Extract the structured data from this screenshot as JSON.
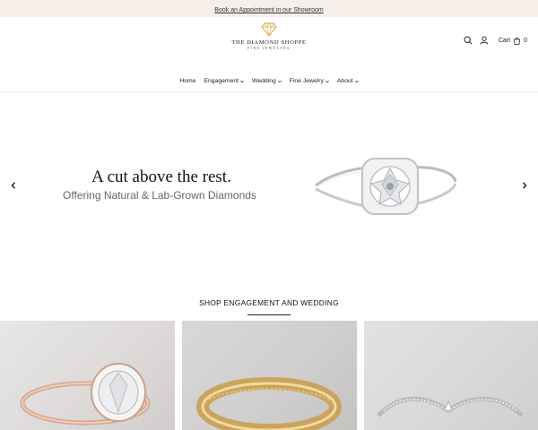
{
  "announcement": {
    "link_text": "Book an Appointment in our Showroom"
  },
  "logo": {
    "brand": "THE DIAMOND SHOPPE",
    "tagline": "FINE JEWELERS",
    "icon": "diamond-icon"
  },
  "header": {
    "search_icon": "search-icon",
    "account_icon": "user-icon",
    "cart_label": "Cart",
    "cart_icon": "bag-icon",
    "cart_count": "0"
  },
  "nav": {
    "home": "Home",
    "engagement": "Engagement",
    "wedding": "Wedding",
    "fine_jewelry": "Fine Jewelry",
    "about": "About"
  },
  "hero": {
    "title": "A cut above the rest.",
    "subtitle": "Offering Natural & Lab-Grown Diamonds",
    "prev_icon": "chevron-left-icon",
    "next_icon": "chevron-right-icon"
  },
  "section": {
    "title": "SHOP ENGAGEMENT AND WEDDING"
  },
  "colors": {
    "announcement_bg": "#f6efe9",
    "text": "#111111",
    "gold": "#d4aa4a"
  }
}
